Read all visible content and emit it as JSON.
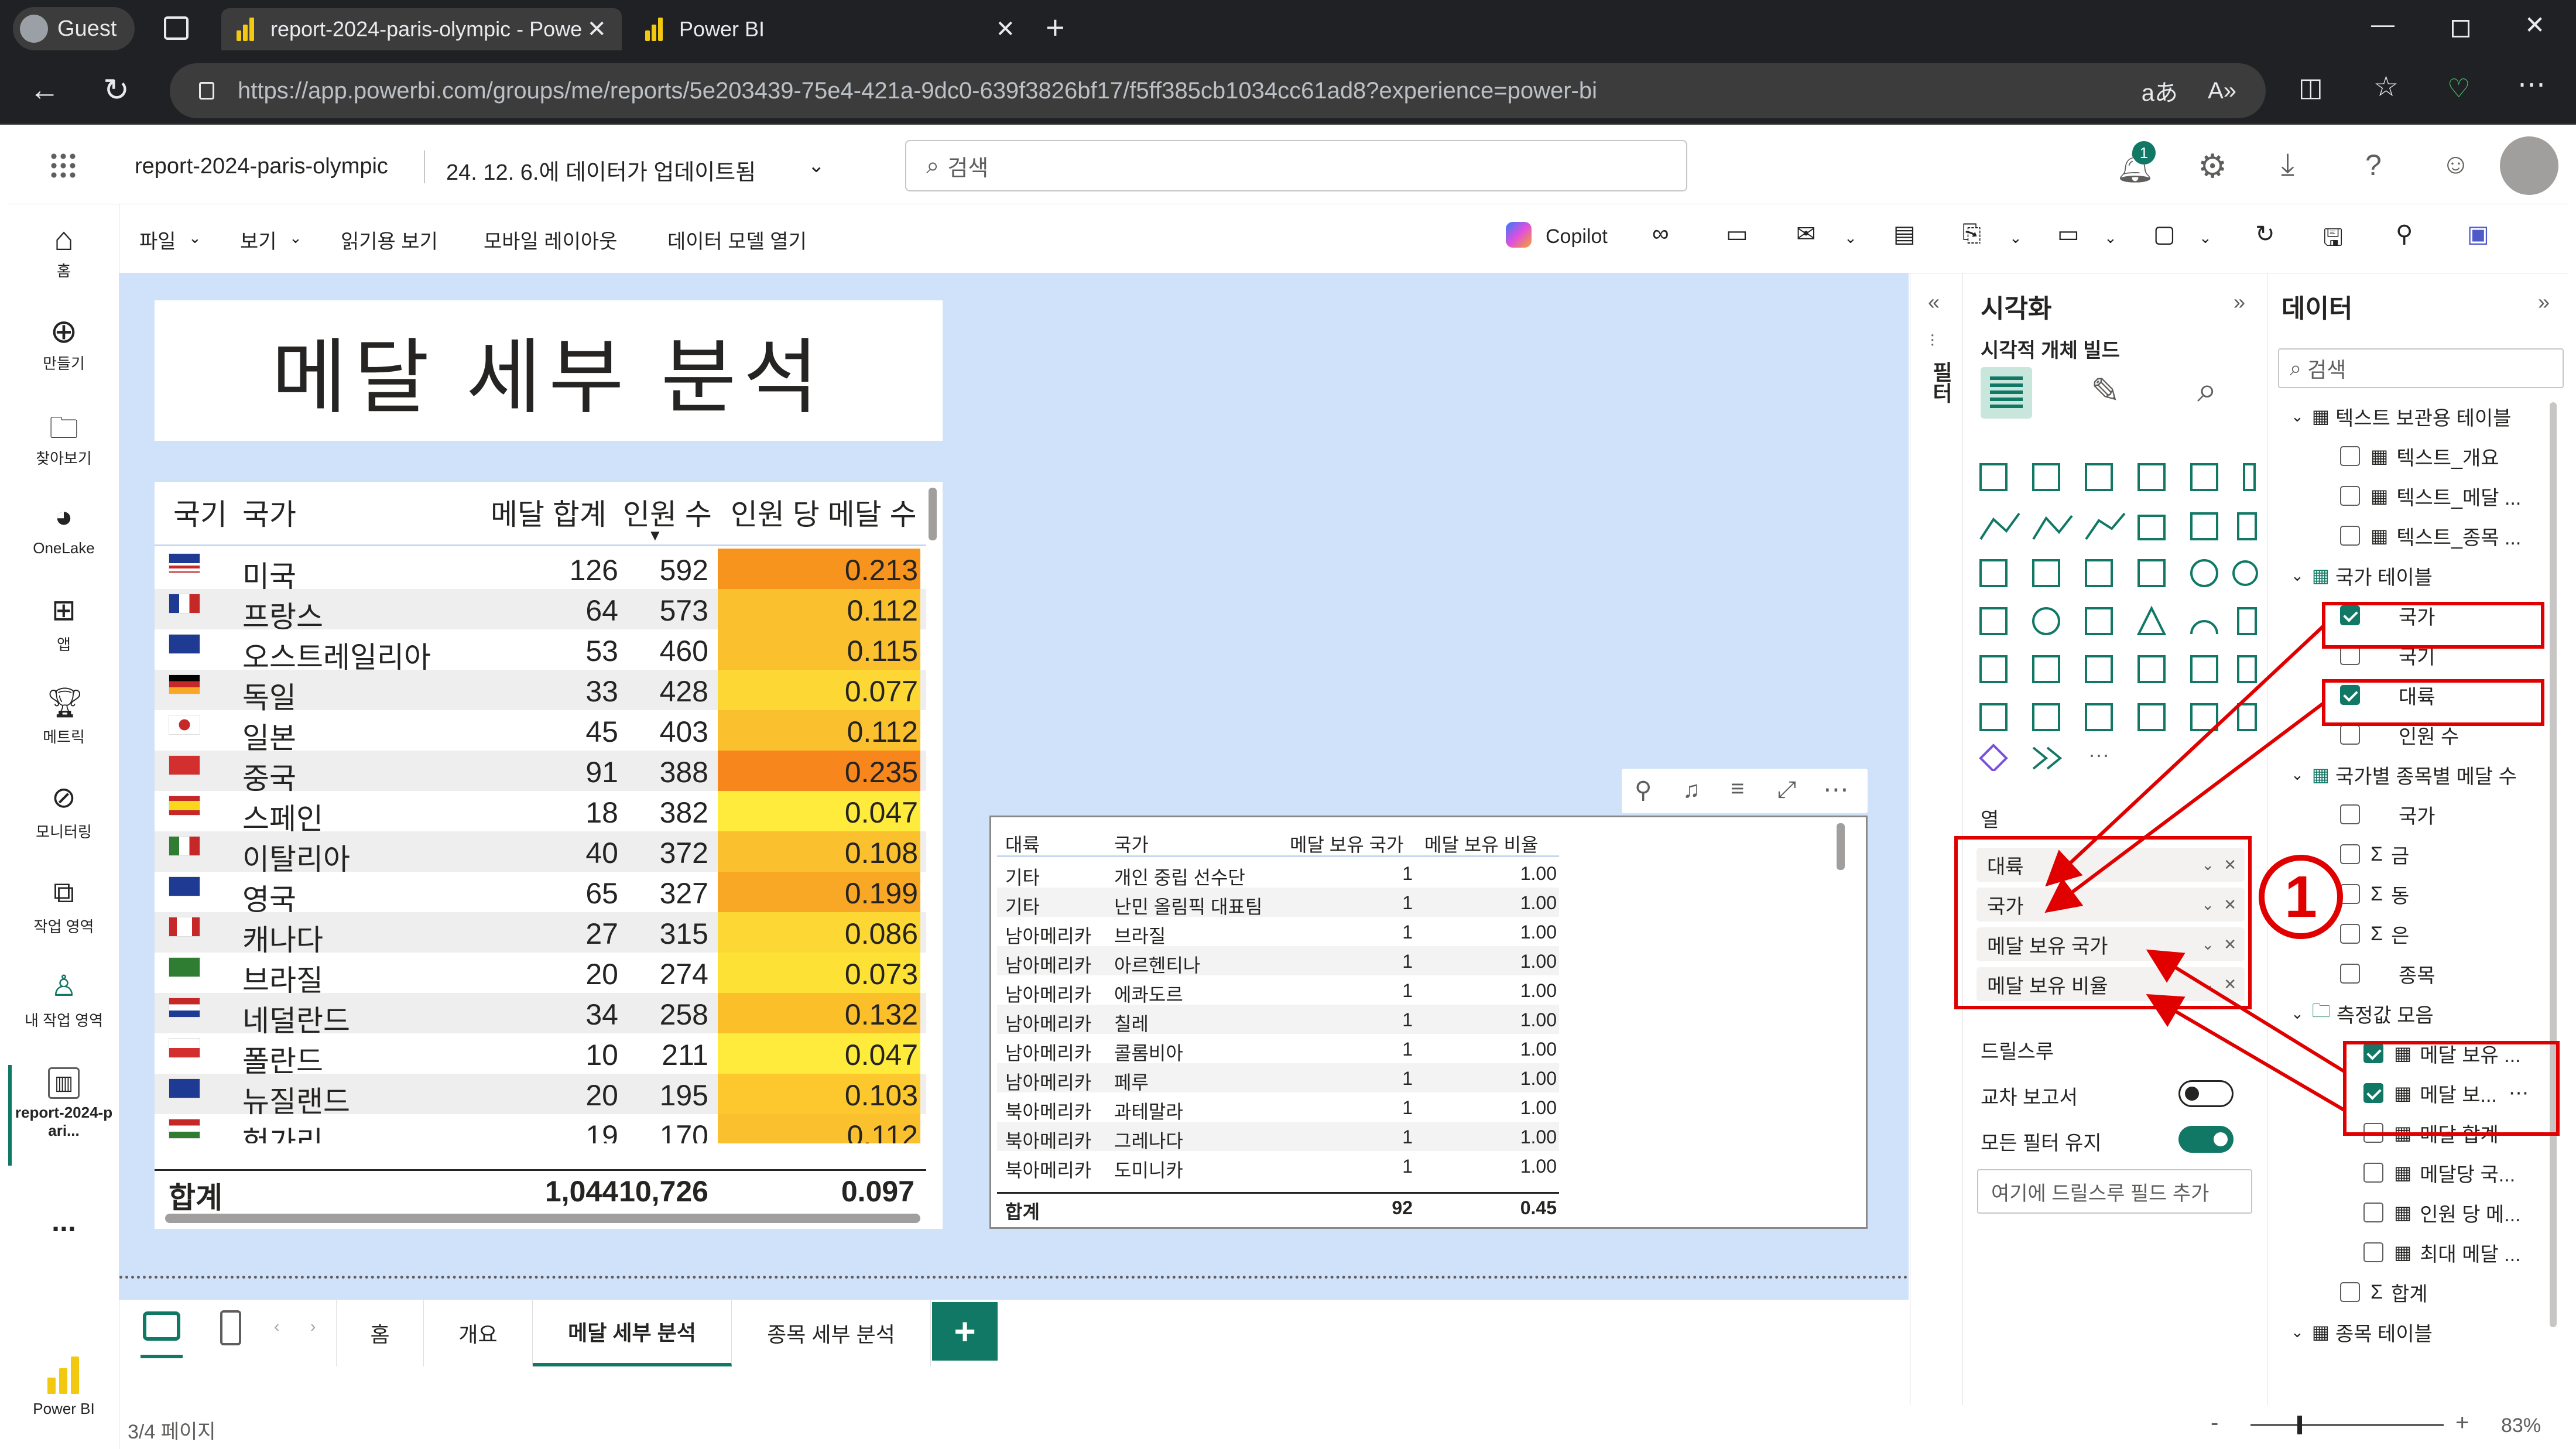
{
  "browser": {
    "profile": "Guest",
    "tabs": [
      {
        "title": "report-2024-paris-olympic - Powe"
      },
      {
        "title": "Power BI"
      }
    ],
    "url": "https://app.powerbi.com/groups/me/reports/5e203439-75e4-421a-9dc0-639f3826bf17/f5ff385cb1034cc61ad8?experience=power-bi"
  },
  "header": {
    "report_name": "report-2024-paris-olympic",
    "updated": "24. 12. 6.에 데이터가 업데이트됨",
    "search_placeholder": "검색",
    "notification_count": "1"
  },
  "leftnav": {
    "items": [
      "홈",
      "만들기",
      "찾아보기",
      "OneLake",
      "앱",
      "메트릭",
      "모니터링",
      "작업 영역",
      "내 작업 영역",
      "report-2024-pari..."
    ],
    "more": "...",
    "brand": "Power BI"
  },
  "ribbon": {
    "file": "파일",
    "view": "보기",
    "reading_view": "읽기용 보기",
    "mobile_layout": "모바일 레이아웃",
    "open_model": "데이터 모델 열기",
    "copilot": "Copilot"
  },
  "page_title": "메달 세부 분석",
  "main_table": {
    "headers": [
      "국기",
      "국가",
      "메달 합계",
      "인원 수",
      "인원 당 메달 수"
    ],
    "rows": [
      {
        "country": "미국",
        "medals": "126",
        "people": "592",
        "ratio": "0.213",
        "flag": "us",
        "heat": "#f7941d"
      },
      {
        "country": "프랑스",
        "medals": "64",
        "people": "573",
        "ratio": "0.112",
        "flag": "fr",
        "heat": "#fbc02d"
      },
      {
        "country": "오스트레일리아",
        "medals": "53",
        "people": "460",
        "ratio": "0.115",
        "flag": "au",
        "heat": "#fbc02d"
      },
      {
        "country": "독일",
        "medals": "33",
        "people": "428",
        "ratio": "0.077",
        "flag": "de",
        "heat": "#fdd835"
      },
      {
        "country": "일본",
        "medals": "45",
        "people": "403",
        "ratio": "0.112",
        "flag": "jp",
        "heat": "#fbc02d"
      },
      {
        "country": "중국",
        "medals": "91",
        "people": "388",
        "ratio": "0.235",
        "flag": "cn",
        "heat": "#f7871d"
      },
      {
        "country": "스페인",
        "medals": "18",
        "people": "382",
        "ratio": "0.047",
        "flag": "es",
        "heat": "#ffeb3b"
      },
      {
        "country": "이탈리아",
        "medals": "40",
        "people": "372",
        "ratio": "0.108",
        "flag": "it",
        "heat": "#fbc02d"
      },
      {
        "country": "영국",
        "medals": "65",
        "people": "327",
        "ratio": "0.199",
        "flag": "gb",
        "heat": "#f9a825"
      },
      {
        "country": "캐나다",
        "medals": "27",
        "people": "315",
        "ratio": "0.086",
        "flag": "ca",
        "heat": "#fdd835"
      },
      {
        "country": "브라질",
        "medals": "20",
        "people": "274",
        "ratio": "0.073",
        "flag": "br",
        "heat": "#fee135"
      },
      {
        "country": "네덜란드",
        "medals": "34",
        "people": "258",
        "ratio": "0.132",
        "flag": "nl",
        "heat": "#fbbf2a"
      },
      {
        "country": "폴란드",
        "medals": "10",
        "people": "211",
        "ratio": "0.047",
        "flag": "pl",
        "heat": "#ffeb3b"
      },
      {
        "country": "뉴질랜드",
        "medals": "20",
        "people": "195",
        "ratio": "0.103",
        "flag": "nz",
        "heat": "#fcc82e"
      },
      {
        "country": "헝가리",
        "medals": "19",
        "people": "170",
        "ratio": "0.112",
        "flag": "hu",
        "heat": "#fbc02d"
      }
    ],
    "total": {
      "label": "합계",
      "medals": "1,044",
      "people": "10,726",
      "ratio": "0.097"
    }
  },
  "matrix": {
    "headers": [
      "대륙",
      "국가",
      "메달 보유 국가",
      "메달 보유 비율"
    ],
    "rows": [
      [
        "기타",
        "개인 중립 선수단",
        "1",
        "1.00"
      ],
      [
        "기타",
        "난민 올림픽 대표팀",
        "1",
        "1.00"
      ],
      [
        "남아메리카",
        "브라질",
        "1",
        "1.00"
      ],
      [
        "남아메리카",
        "아르헨티나",
        "1",
        "1.00"
      ],
      [
        "남아메리카",
        "에콰도르",
        "1",
        "1.00"
      ],
      [
        "남아메리카",
        "칠레",
        "1",
        "1.00"
      ],
      [
        "남아메리카",
        "콜롬비아",
        "1",
        "1.00"
      ],
      [
        "남아메리카",
        "페루",
        "1",
        "1.00"
      ],
      [
        "북아메리카",
        "과테말라",
        "1",
        "1.00"
      ],
      [
        "북아메리카",
        "그레나다",
        "1",
        "1.00"
      ],
      [
        "북아메리카",
        "도미니카",
        "1",
        "1.00"
      ]
    ],
    "total": {
      "label": "합계",
      "count": "92",
      "ratio": "0.45"
    }
  },
  "filters_label": "필터",
  "viz": {
    "title": "시각화",
    "subtitle": "시각적 개체 빌드",
    "columns_label": "열",
    "wells": [
      "대륙",
      "국가",
      "메달 보유 국가",
      "메달 보유 비율"
    ],
    "drillthrough": "드릴스루",
    "cross_report": "교차 보고서",
    "keep_filters": "모든 필터 유지",
    "add_field": "여기에 드릴스루 필드 추가",
    "marker": "1"
  },
  "data": {
    "title": "데이터",
    "search_placeholder": "검색",
    "items": [
      {
        "label": "텍스트 보관용 테이블",
        "type": "table"
      },
      {
        "label": "텍스트_개요",
        "type": "measure",
        "checked": false
      },
      {
        "label": "텍스트_메달 ...",
        "type": "measure",
        "checked": false
      },
      {
        "label": "텍스트_종목 ...",
        "type": "measure",
        "checked": false
      },
      {
        "label": "국가 테이블",
        "type": "table"
      },
      {
        "label": "국가",
        "type": "field",
        "checked": true
      },
      {
        "label": "국기",
        "type": "field",
        "checked": false
      },
      {
        "label": "대륙",
        "type": "field",
        "checked": true
      },
      {
        "label": "인원 수",
        "type": "field",
        "checked": false
      },
      {
        "label": "국가별 종목별 메달 수",
        "type": "table"
      },
      {
        "label": "국가",
        "type": "field",
        "checked": false
      },
      {
        "label": "금",
        "type": "sum",
        "checked": false
      },
      {
        "label": "동",
        "type": "sum",
        "checked": false
      },
      {
        "label": "은",
        "type": "sum",
        "checked": false
      },
      {
        "label": "종목",
        "type": "field",
        "checked": false
      },
      {
        "label": "측정값 모음",
        "type": "folder"
      },
      {
        "label": "메달 보유 ...",
        "type": "measure",
        "checked": true
      },
      {
        "label": "메달 보...",
        "type": "measure",
        "checked": true
      },
      {
        "label": "메달 합계",
        "type": "measure",
        "checked": false
      },
      {
        "label": "메달당 국...",
        "type": "measure",
        "checked": false
      },
      {
        "label": "인원 당 메...",
        "type": "measure",
        "checked": false
      },
      {
        "label": "최대 메달 ...",
        "type": "measure",
        "checked": false
      },
      {
        "label": "합계",
        "type": "sum",
        "checked": false
      },
      {
        "label": "종목 테이블",
        "type": "table"
      }
    ]
  },
  "pages": {
    "tabs": [
      "홈",
      "개요",
      "메달 세부 분석",
      "종목 세부 분석"
    ],
    "active": 2,
    "add": "+"
  },
  "status": {
    "page_indicator": "3/4 페이지",
    "zoom": "83%"
  },
  "colors": {
    "accent": "#117865",
    "annotation": "#e00000",
    "canvas": "#cfe2f9"
  }
}
